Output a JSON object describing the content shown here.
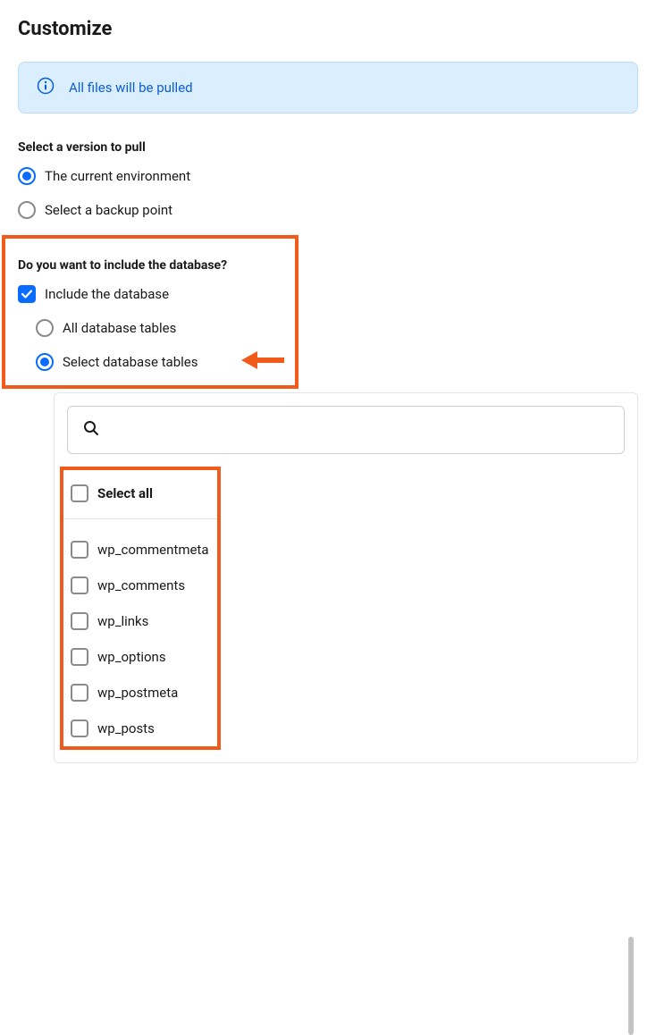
{
  "header": {
    "title": "Customize"
  },
  "banner": {
    "text": "All files will be pulled"
  },
  "version": {
    "label": "Select a version to pull",
    "options": [
      {
        "label": "The current environment",
        "selected": true
      },
      {
        "label": "Select a backup point",
        "selected": false
      }
    ]
  },
  "database": {
    "label": "Do you want to include the database?",
    "include": {
      "label": "Include the database",
      "checked": true
    },
    "mode": [
      {
        "label": "All database tables",
        "selected": false
      },
      {
        "label": "Select database tables",
        "selected": true
      }
    ]
  },
  "tables": {
    "select_all": {
      "label": "Select all",
      "checked": false
    },
    "items": [
      {
        "name": "wp_commentmeta",
        "checked": false
      },
      {
        "name": "wp_comments",
        "checked": false
      },
      {
        "name": "wp_links",
        "checked": false
      },
      {
        "name": "wp_options",
        "checked": false
      },
      {
        "name": "wp_postmeta",
        "checked": false
      },
      {
        "name": "wp_posts",
        "checked": false
      }
    ]
  },
  "colors": {
    "accent": "#0a6cff",
    "highlight": "#f05a1a",
    "banner_bg": "#dbeefd",
    "banner_text": "#0a5ed9"
  }
}
